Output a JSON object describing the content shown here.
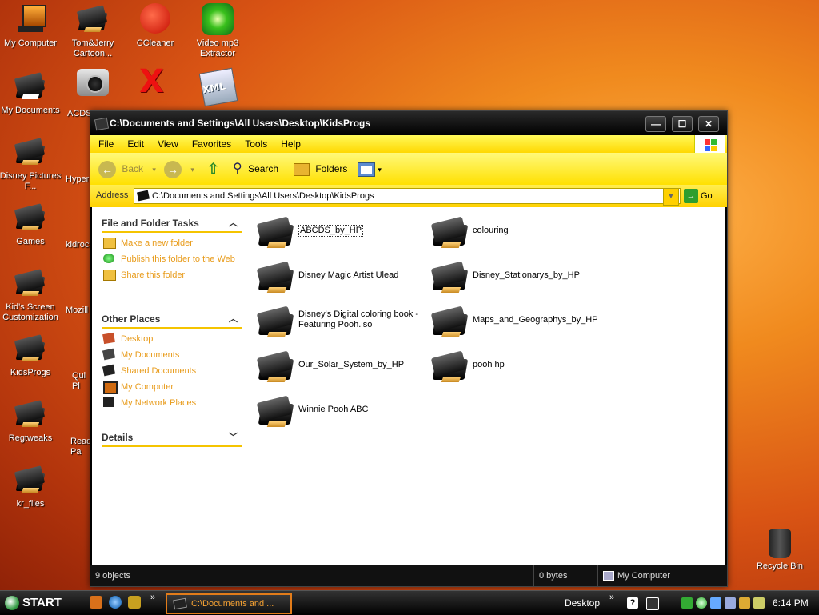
{
  "desktop": {
    "icons": [
      {
        "label": "My Computer"
      },
      {
        "label": "Tom&Jerry Cartoon..."
      },
      {
        "label": "CCleaner"
      },
      {
        "label": "Video mp3 Extractor"
      },
      {
        "label": "My Documents"
      },
      {
        "label": "ACDS"
      },
      {
        "label": "Disney Pictures F..."
      },
      {
        "label": "Hyper"
      },
      {
        "label": "Games"
      },
      {
        "label": "kidroc"
      },
      {
        "label": "Kid's Screen Customization"
      },
      {
        "label": "Mozill"
      },
      {
        "label": "KidsProgs"
      },
      {
        "label": "Qui Pl"
      },
      {
        "label": "Regtweaks"
      },
      {
        "label": "Read Pa"
      },
      {
        "label": "kr_files"
      },
      {
        "label": "Recycle Bin"
      }
    ]
  },
  "window": {
    "title": "C:\\Documents and Settings\\All Users\\Desktop\\KidsProgs",
    "buttons": {
      "minimize": "—",
      "maximize": "☐",
      "close": "✕"
    },
    "menu": [
      "File",
      "Edit",
      "View",
      "Favorites",
      "Tools",
      "Help"
    ],
    "toolbar": {
      "back": "Back",
      "search": "Search",
      "folders": "Folders"
    },
    "address": {
      "label": "Address",
      "value": "C:\\Documents and Settings\\All Users\\Desktop\\KidsProgs",
      "go": "Go"
    },
    "tasks": {
      "title": "File and Folder Tasks",
      "items": [
        "Make a new folder",
        "Publish this folder to the Web",
        "Share this folder"
      ]
    },
    "other_places": {
      "title": "Other Places",
      "items": [
        "Desktop",
        "My Documents",
        "Shared Documents",
        "My Computer",
        "My Network Places"
      ]
    },
    "details": {
      "title": "Details"
    },
    "files": [
      {
        "name": "ABCDS_by_HP"
      },
      {
        "name": "colouring"
      },
      {
        "name": "Disney Magic Artist Ulead"
      },
      {
        "name": "Disney_Stationarys_by_HP"
      },
      {
        "name": "Disney's Digital coloring book - Featuring Pooh.iso"
      },
      {
        "name": "Maps_and_Geographys_by_HP"
      },
      {
        "name": "Our_Solar_System_by_HP"
      },
      {
        "name": "pooh hp"
      },
      {
        "name": "Winnie Pooh ABC"
      }
    ],
    "status": {
      "objects": "9 objects",
      "size": "0 bytes",
      "location": "My Computer"
    }
  },
  "taskbar": {
    "start": "START",
    "task": "C:\\Documents and ...",
    "desktop_label": "Desktop",
    "chevron": "»",
    "time": "6:14 PM"
  }
}
